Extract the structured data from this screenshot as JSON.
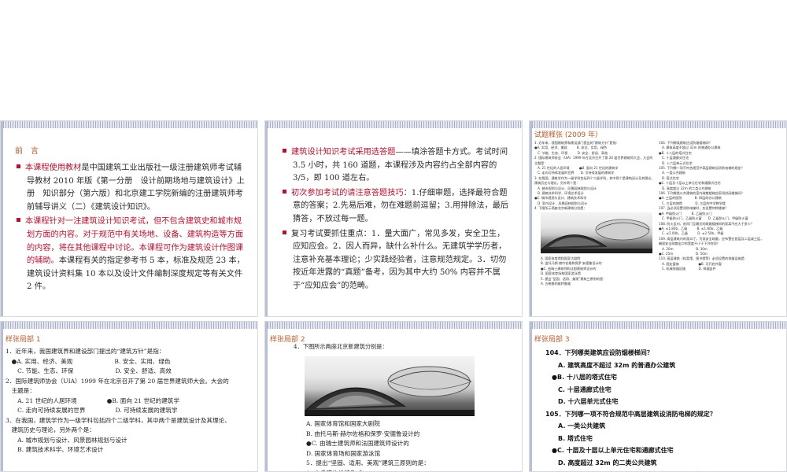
{
  "slide1": {
    "title": "前　言",
    "p1_red": "本课程使用教材",
    "p1_rest": "是中国建筑工业出版社一级注册建筑师考试辅导教材 2010 年版《第一分册　设计前期场地与建筑设计》上册　知识部分（第六版）和北京建工学院新编的注册建筑师考前辅导讲义（二）《建筑设计知识》。",
    "p2_red": "本课程针对一注建筑设计知识考试，但不包含建筑史和城市规划方面的内容。对于规范中有关场地、设备、建筑构造等方面的内容，将在其他课程中讨论。本课程可作为建筑设计作图课的辅助。",
    "p2_rest": "本课程有关的指定参考书 5 本，标准及规范 23 本，建筑设计资料集 10 本以及设计文件编制深度规定等有关文件 2 件。"
  },
  "slide2": {
    "p1_red": "建筑设计知识考试采用选答题",
    "p1_rest": "——填涂答题卡方式。考试时间 3.5 小时，共 160 道题，本课程涉及内容约占全部内容的 3/5，即 100 道左右。",
    "p2_red": "初次参加考试的请注意答题技巧",
    "p2_rest": "：1.仔细审题，选择最符合题意的答案；2.先易后难，勿在难题前逗留；3.用排除法，最后猜答，不放过每一题。",
    "p3": "复习考试要抓住重点：1．量大面广，常见多发，安全卫生，应知应会。2．因人而异，缺什么补什么。无建筑学学历者，注意补充基本理论；少实践经验者，注意规范规定。3．切勿按近年泄露的“真题”备考，因为其中大约 50% 内容并不属于“应知应会”的范畴。"
  },
  "slide3": {
    "title": "试题释张 (2009 年）",
    "left_lines": [
      "1. 近年来，我国建筑界和建设部门提出的“建筑方针”是指：",
      "●A. 实用、经济、美观　　　B. 安全、实用、绿色",
      "　C. 节能、生态、环保　　　D. 安全、舒适、高效",
      "2. 国际建筑师协会（UIA）1999 年在北京召开了第 20 届世界建筑师大会，大会的",
      "主题是：",
      "　A. 21 世纪的人居环境　　　●B. 面向 21 世纪的建筑学",
      "　C. 走向可持续发展的世界　　D. 可持续发展的建筑学",
      "3. 在我国，建筑学作为一级学科包括四个二级学科，其中两个是建筑设计及其理论、",
      "建筑历史与理论，另外两个是：",
      "　A. 城市规划与设计、风景园林规划与设计",
      "　B. 建筑技术科学、环境艺术设计",
      "●C. 城市规划与设计、建筑技术科学",
      "　D. 室内设计、风景园林规划与设计",
      "4. 下图所示两座北京新建筑分别是："
    ],
    "left_after_photo": [
      "A. 国家体育馆和国家大剧院",
      "B. 由托马斯·赫尔佐格和保罗·安德鲁设计的",
      "●C. 由瑞士建筑师和法国建筑师设计的",
      "D. 国家体育场和国家游泳馆",
      "5. 提出“坚固、适用、美观”建筑三原则的是：",
      "A. 古希腊的维特鲁威"
    ],
    "right_lines": [
      "104. 下列哪类建筑应设防烟楼梯间？",
      "　A. 建筑高度不超过 32m 的普通办公建筑",
      "●B. 十八层的塔式住宅",
      "　C. 十层通廊式住宅",
      "　D. 十六层单元式住宅",
      "105. 下列哪一项不符合规范中高层建筑设消防电梯的规定？",
      "　A. 一类公共建筑",
      "　B. 塔式住宅",
      "●C. 十层及十层以上单元住宅和通廊式住宅",
      "　D. 高度超过 32m 的二类公共建筑",
      "106. 下列哪类公共建筑的室内疏散楼梯应采用封闭楼梯间？",
      "●A. 三层的医院　　　　B. 四层的办公建筑",
      "　C. 三层的旅馆　　　　D. 三层的中学教学楼",
      "107. 当必须设置消防电梯时，应设置何种楼梯？",
      "●A. 甲级防火门　　　B. 乙级防火门",
      "　C. 甲级防火门，乙级防火窗　　D. 乙级防火门，甲级防火窗",
      "108. 防火区内，房间门至最近的疏散楼梯间的距离不应大于多少？",
      "●A. ≤1.80b，乙级　　　B. ≤1.80b，乙级",
      "　C. ≤2.00b，乙级　　　D. ≤2.50b，甲级",
      "109. 高层建筑内的观众厅，为其安全疏散，应布置在首层及二层或三层，",
      "确保安全疏散出口的宽度不小于下列何项？",
      "　A. 20m　　　　　　　B. 30m",
      "●C. 25m　　　　　　　D. 50m",
      "110. 高层建筑（档案馆、图书馆等）必须设置的排烟设施是：",
      "　A. 固定窗扇　　　　　　●B. 可开启外窗",
      "　C. 机械排烟设施　　　　D. 排烟竖井"
    ]
  },
  "slide4": {
    "title": "样张局部 1",
    "lines": [
      "1．近年来，我国建筑界和建设部门提出的“建筑方针”是指：",
      "　●A. 实用、经济、美观　　　　　　　B. 安全、实用、绿色",
      "　　C. 节能、生态、环保　　　　　　　D. 安全、舒适、高效",
      "2．国际建筑师协会（UIA）1999 年在北京召开了第 20 届世界建筑师大会。大会的",
      "　主题是：",
      "　　A. 21 世纪的人居环境　　　　　●B. 面向 21 世纪的建筑学",
      "　　C. 走向可持续发展的世界　　　　　D. 可持续发展的建筑学",
      "3．在我国，建筑学作为一级学科包括四个二级学科，其中两个是建筑设计及其理论、",
      "　建筑历史与理论，另外两个是：",
      "　　A. 城市规划与设计、风景园林规划与设计",
      "　　B. 建筑技术科学、环境艺术设计"
    ]
  },
  "slide5": {
    "title": "样张局部 2",
    "q4": "4．下图所示两座北京新建筑分别是：",
    "options": [
      "A. 国家体育馆和国家大剧院",
      "B. 由托马斯·赫尔佐格和保罗·安德鲁设计的",
      "●C. 由瑞士建筑师和法国建筑师设计的",
      "D. 国家体育场和国家游泳馆",
      "5．提出“坚固、适用、美观”建筑三原则的是：",
      "A. 古希腊的维特鲁威"
    ]
  },
  "slide6": {
    "title": "样张局部 3",
    "lines": [
      "104．下列哪类建筑应设防烟楼梯间？",
      "　　A. 建筑高度不超过 32m 的普通办公建筑",
      "　●B. 十八层的塔式住宅",
      "　　C. 十层通廊式住宅",
      "　　D. 十六层单元式住宅",
      "105．下列哪一项不符合规范中高层建筑设消防电梯的规定？",
      "　　A. 一类公共建筑",
      "　　B. 塔式住宅",
      "　●C. 十层及十层以上单元住宅和通廊式住宅",
      "　　D. 高度超过 32m 的二类公共建筑",
      "106．下列哪类公共建筑的室内疏散楼梯应采用封闭楼梯间？"
    ]
  },
  "colors": {
    "accent_red": "#b8102d",
    "title_orange": "#b85a2a",
    "hatch": "#a9b0c6"
  }
}
